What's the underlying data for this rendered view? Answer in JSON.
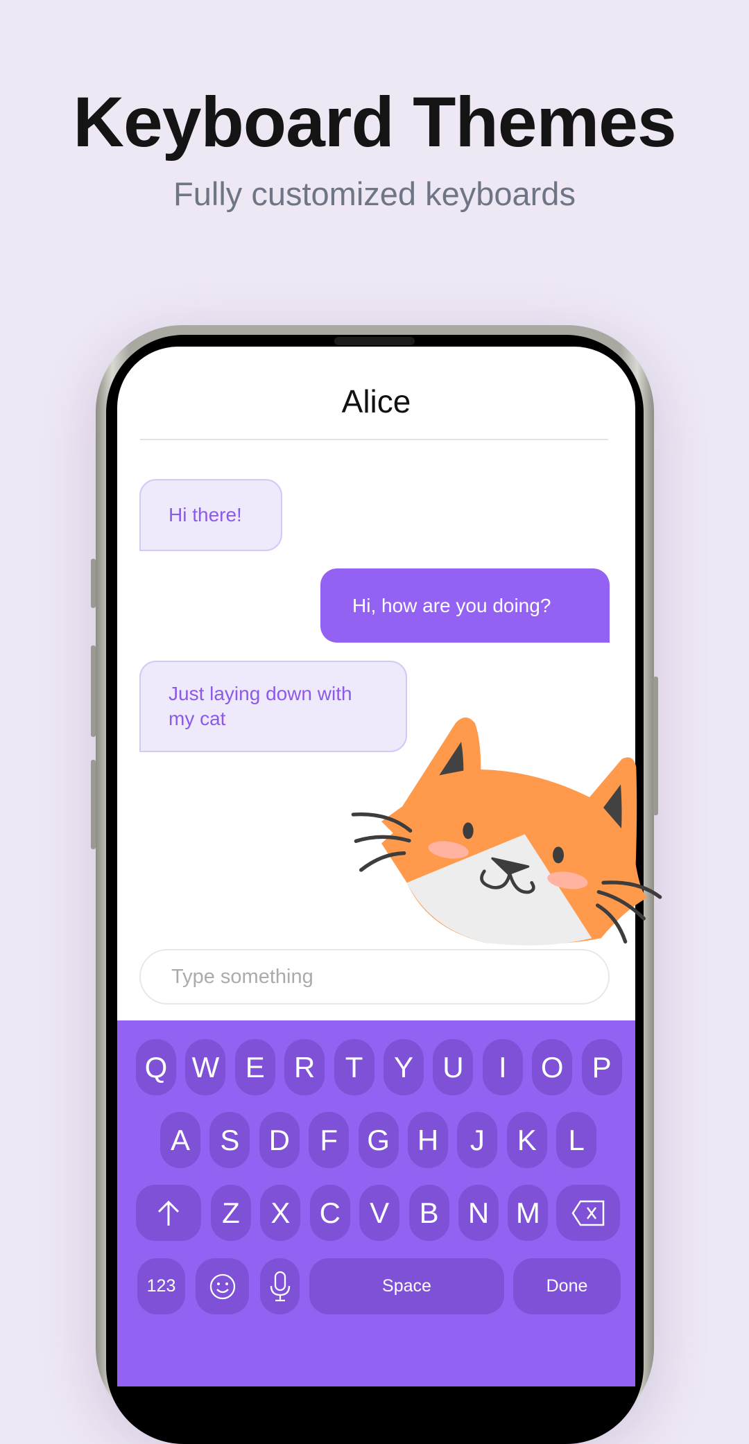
{
  "header": {
    "title": "Keyboard Themes",
    "subtitle": "Fully customized keyboards"
  },
  "chat": {
    "contact_name": "Alice",
    "messages": [
      {
        "text": "Hi there!",
        "direction": "incoming"
      },
      {
        "text": "Hi, how are you doing?",
        "direction": "outgoing"
      },
      {
        "text": "Just laying down with my cat",
        "direction": "incoming"
      }
    ],
    "sticker": "cat-sticker",
    "input_placeholder": "Type something"
  },
  "keyboard": {
    "row1": [
      "Q",
      "W",
      "E",
      "R",
      "T",
      "Y",
      "U",
      "I",
      "O",
      "P"
    ],
    "row2": [
      "A",
      "S",
      "D",
      "F",
      "G",
      "H",
      "J",
      "K",
      "L"
    ],
    "row3": [
      "Z",
      "X",
      "C",
      "V",
      "B",
      "N",
      "M"
    ],
    "shift_icon": "arrow-up-icon",
    "backspace_icon": "backspace-icon",
    "numbers_label": "123",
    "emoji_icon": "smiley-icon",
    "mic_icon": "microphone-icon",
    "space_label": "Space",
    "done_label": "Done"
  },
  "colors": {
    "accent": "#9462F2",
    "key": "#7F51D6",
    "bubble_in": "#EFE9FC",
    "background": "#EEE7F4",
    "cat": "#FF9A4C"
  }
}
